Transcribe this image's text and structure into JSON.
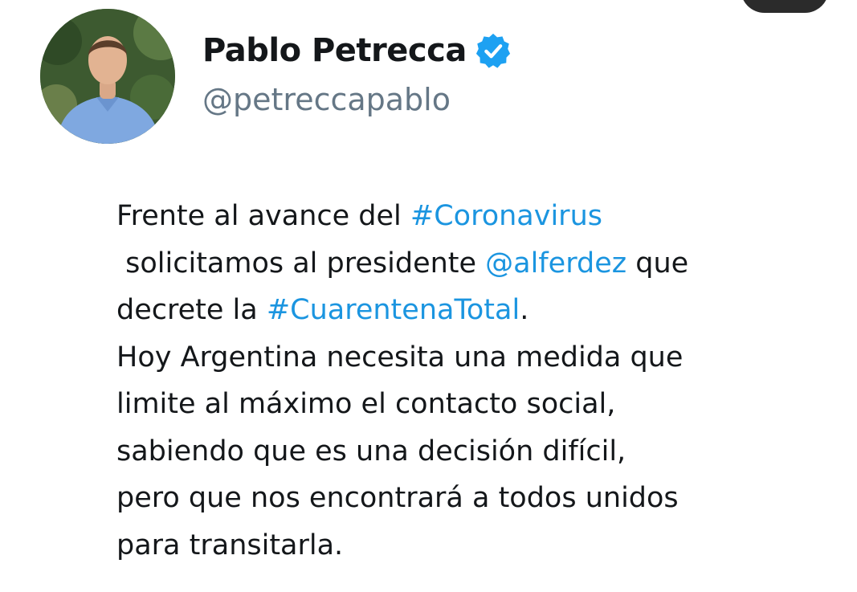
{
  "author": {
    "display_name": "Pablo Petrecca",
    "handle": "@petreccapablo",
    "verified": true
  },
  "tweet": {
    "line1": {
      "t1": "Frente al avance del ",
      "hashtag1": "#Coronavirus"
    },
    "line2": {
      "t1": " solicitamos al presidente ",
      "mention": "@alferdez",
      "t2": " que"
    },
    "line3": {
      "t1": "decrete la ",
      "hashtag2": "#CuarentenaTotal",
      "t2": "."
    },
    "line4": "Hoy Argentina necesita una medida que",
    "line5": "limite al máximo el contacto social,",
    "line6": "sabiendo que es una decisión difícil,",
    "line7": "pero que nos encontrará a todos unidos",
    "line8": "para transitarla."
  },
  "colors": {
    "link": "#1b95e0",
    "verified_badge": "#1da1f2",
    "handle": "#657786",
    "text": "#14171a"
  },
  "icons": {
    "verified": "verified-badge-icon",
    "avatar": "profile-photo"
  }
}
